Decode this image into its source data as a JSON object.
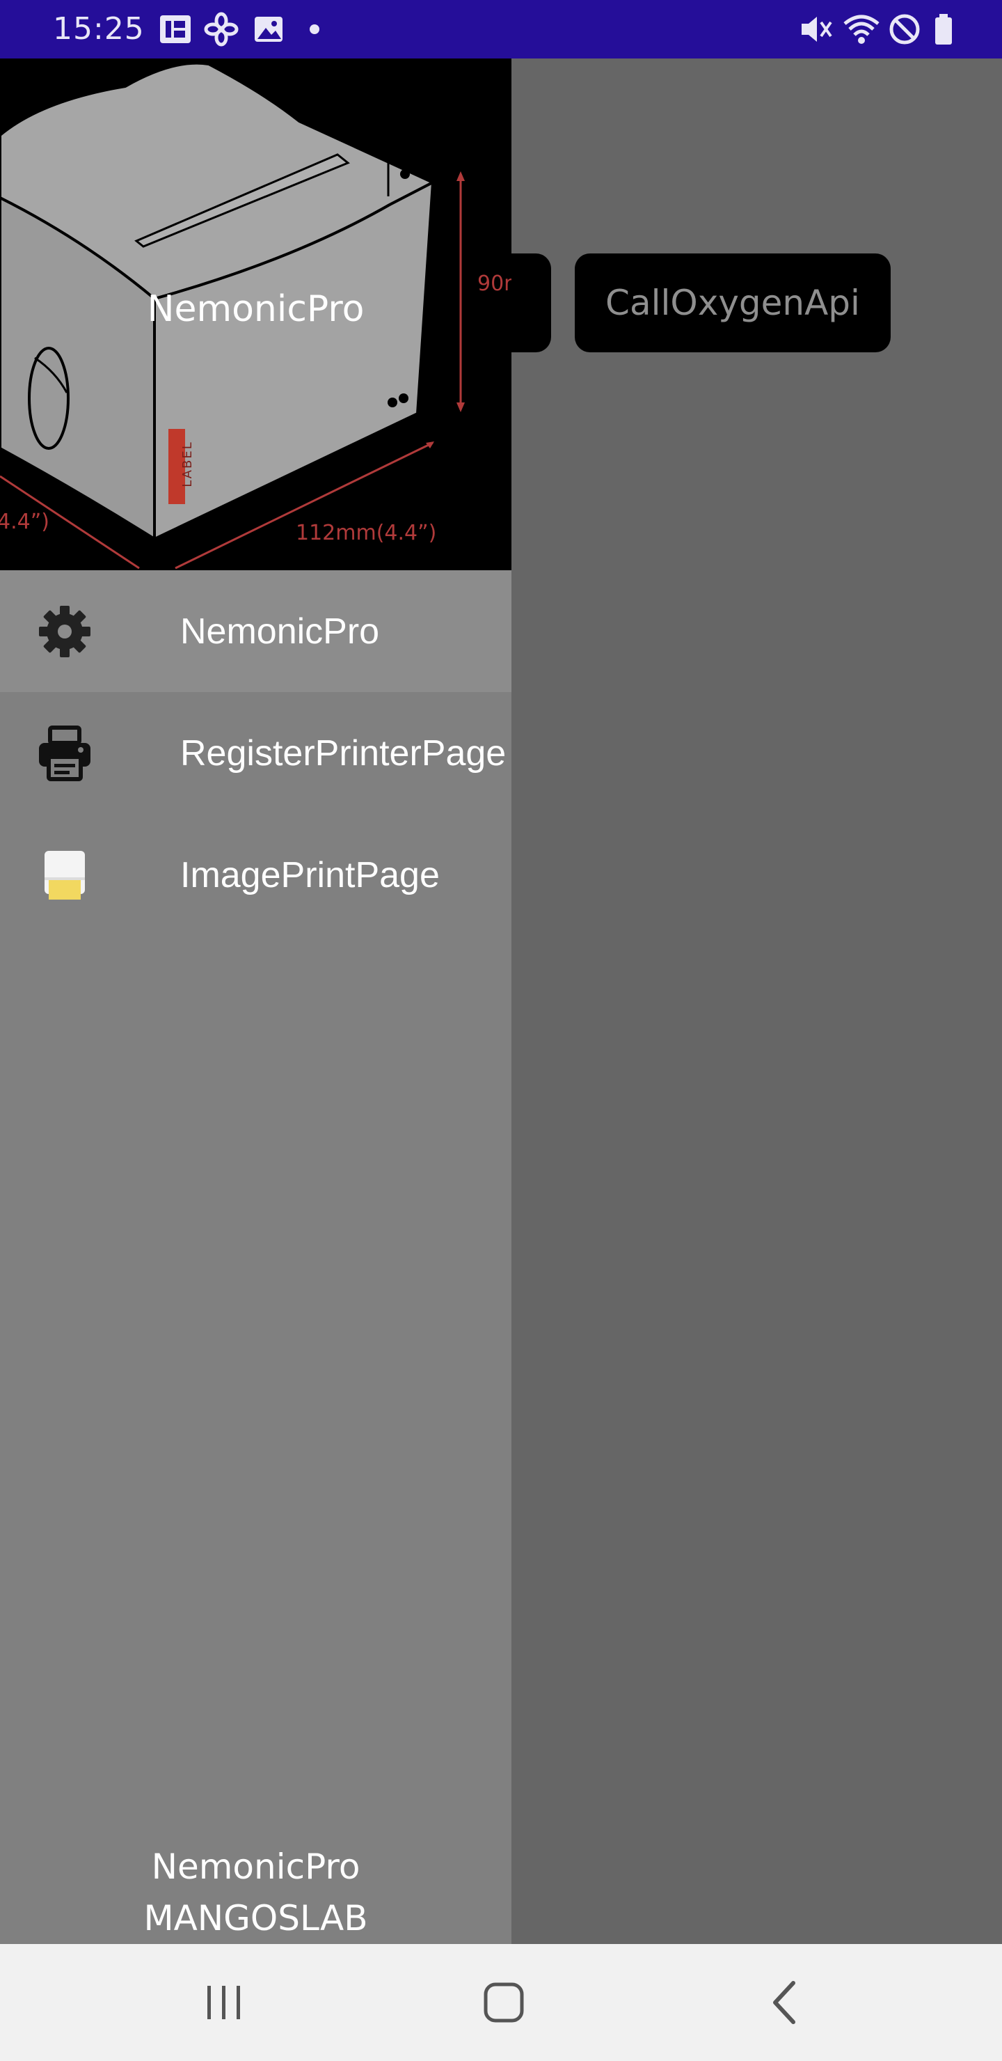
{
  "status_bar": {
    "time": "15:25",
    "left_icons": [
      "sim-card-icon",
      "fan-icon",
      "gallery-icon",
      "dot-icon"
    ],
    "right_icons": [
      "mute-icon",
      "wifi-icon",
      "do-not-disturb-icon",
      "battery-icon"
    ],
    "background_color": "#250e99"
  },
  "background_app": {
    "buttons": [
      {
        "label": ""
      },
      {
        "label": "CallOxygenApi"
      }
    ]
  },
  "drawer": {
    "header": {
      "title": "NemonicPro",
      "image_labels": {
        "height": "90r",
        "width": "112mm(4.4”)",
        "depth": "4.4”)",
        "label_text": "LABEL"
      }
    },
    "items": [
      {
        "label": "NemonicPro",
        "icon": "gear-icon",
        "selected": true
      },
      {
        "label": "RegisterPrinterPage",
        "icon": "printer-icon",
        "selected": false
      },
      {
        "label": "ImagePrintPage",
        "icon": "label-printer-icon",
        "selected": false
      }
    ],
    "footer": {
      "line1": "NemonicPro",
      "line2": "MANGOSLAB"
    }
  },
  "nav_bar": {
    "buttons": [
      "recent-apps-icon",
      "home-icon",
      "back-icon"
    ]
  }
}
